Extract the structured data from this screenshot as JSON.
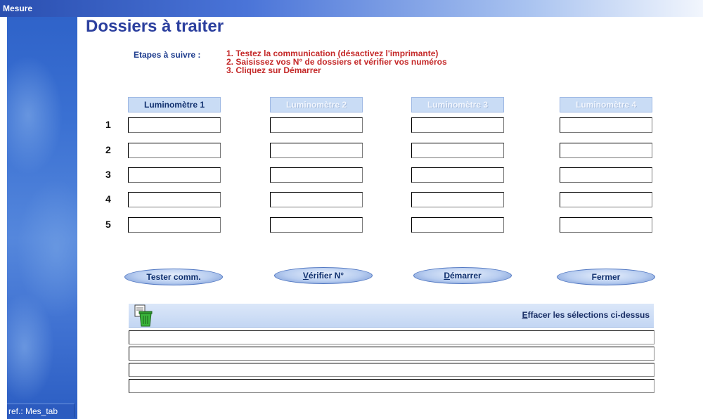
{
  "window": {
    "title": "Mesure"
  },
  "footer": {
    "ref": "ref.: Mes_tab"
  },
  "page": {
    "title": "Dossiers à traiter"
  },
  "steps": {
    "label": "Etapes à suivre :",
    "items": [
      "1. Testez la communication  (désactivez l'imprimante)",
      "2. Saisissez vos N° de dossiers et vérifier vos numéros",
      "3. Cliquez sur Démarrer"
    ]
  },
  "columns": [
    {
      "label": "Luminomètre 1",
      "enabled": true
    },
    {
      "label": "Luminomètre 2",
      "enabled": false
    },
    {
      "label": "Luminomètre 3",
      "enabled": false
    },
    {
      "label": "Luminomètre 4",
      "enabled": false
    }
  ],
  "rows": [
    "1",
    "2",
    "3",
    "4",
    "5"
  ],
  "fields": [
    [
      "",
      "",
      "",
      ""
    ],
    [
      "",
      "",
      "",
      ""
    ],
    [
      "",
      "",
      "",
      ""
    ],
    [
      "",
      "",
      "",
      ""
    ],
    [
      "",
      "",
      "",
      ""
    ]
  ],
  "buttons": {
    "test": "Tester comm.",
    "verify_underline": "V",
    "verify_rest": "érifier N°",
    "start_underline": "D",
    "start_rest": "émarrer",
    "close": "Fermer"
  },
  "clear": {
    "underline": "E",
    "rest": "ffacer les sélections ci-dessus",
    "icon": "trash-icon"
  },
  "messages": [
    "",
    "",
    "",
    ""
  ],
  "colors": {
    "accent": "#2b3f9e",
    "steps_text": "#c42828",
    "sidebar": "#3a70d2"
  }
}
